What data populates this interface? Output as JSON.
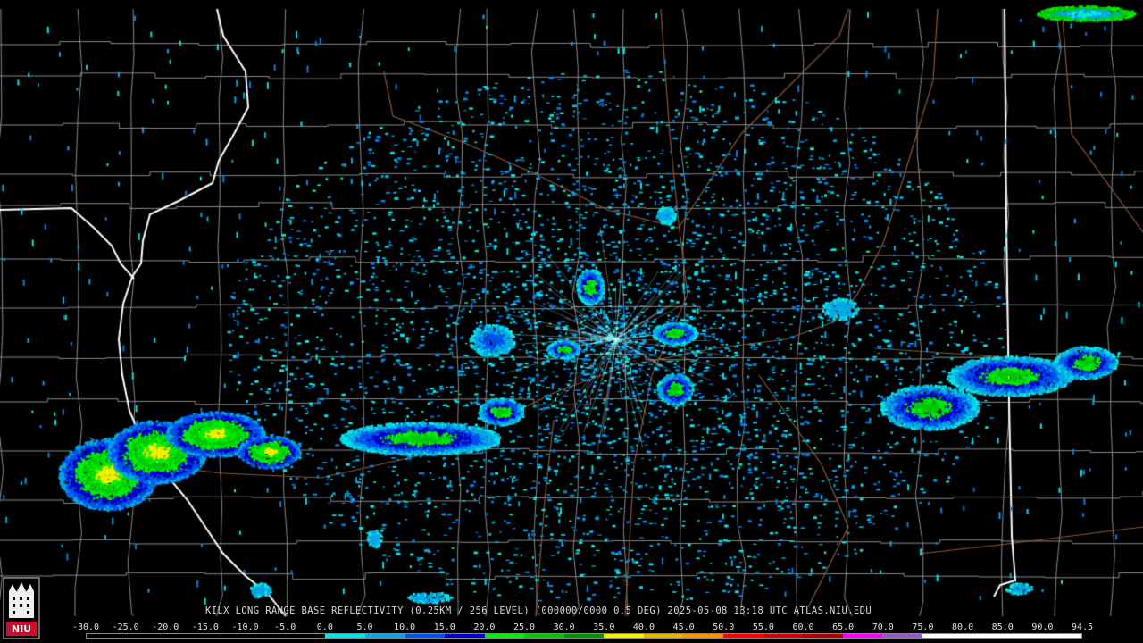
{
  "product": {
    "caption": "KILX LONG RANGE BASE REFLECTIVITY (0.25KM / 256 LEVEL) (000000/0000 0.5 DEG) 2025-05-08 13:18 UTC  ATLAS.NIU.EDU"
  },
  "logo": {
    "label": "NIU",
    "icon": "university-seal-icon"
  },
  "colors": {
    "background": "#000000",
    "county_lines": "#8a8a8a",
    "highways": "#8b5a3c",
    "state_borders": "#ffffff"
  },
  "scale": {
    "labels": [
      "-30.0",
      "-25.0",
      "-20.0",
      "-15.0",
      "-10.0",
      "-5.0",
      "0.0",
      "5.0",
      "10.0",
      "15.0",
      "20.0",
      "25.0",
      "30.0",
      "35.0",
      "40.0",
      "45.0",
      "50.0",
      "55.0",
      "60.0",
      "65.0",
      "70.0",
      "75.0",
      "80.0",
      "85.0",
      "90.0",
      "94.5"
    ],
    "colors": [
      "#000000",
      "#000000",
      "#000000",
      "#000000",
      "#000000",
      "#000000",
      "#05e6e6",
      "#04a8e8",
      "#0050f0",
      "#0000c8",
      "#00f000",
      "#00c800",
      "#009000",
      "#f0f000",
      "#e0b800",
      "#ff9000",
      "#ff0000",
      "#d00000",
      "#b00000",
      "#ff00ff",
      "#9a55c8",
      "#ffffff",
      "#ffffff",
      "#ffffff",
      "#ffffff"
    ]
  }
}
